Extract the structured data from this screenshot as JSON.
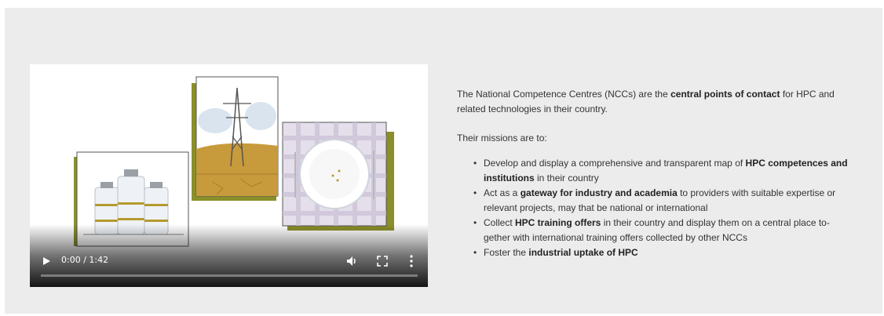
{
  "video": {
    "time": "0:00 / 1:42",
    "progress": 0,
    "icons": {
      "play": "play-icon",
      "volume": "volume-icon",
      "fullscreen": "fullscreen-icon",
      "more": "more-options-icon"
    },
    "illustration": [
      "medicine-bottles",
      "power-pylon-drought",
      "empty-plate-tablecloth"
    ]
  },
  "content": {
    "intro_a": "The National Competence Centres (NCCs) are the ",
    "intro_bold": "central points of contact",
    "intro_b": " for HPC and related technologies in their country.",
    "missions_heading": "Their missions are to:",
    "items": [
      {
        "pre": "Develop and display a comprehensive and transparent map of ",
        "bold": "HPC competences and institutions",
        "post": " in their country"
      },
      {
        "pre": "Act as a ",
        "bold": "gateway for industry and academia",
        "post": " to providers with suitable expertise or relevant projects, may that be national or international"
      },
      {
        "pre": "Collect ",
        "bold": "HPC training offers",
        "post": " in their country and display them on a central place to­gether with international training offers collected by other NCCs"
      },
      {
        "pre": "Foster the ",
        "bold": "industrial uptake of HPC",
        "post": ""
      }
    ]
  },
  "colors": {
    "panel_bg": "#ececec",
    "olive": "#8a8f2a",
    "bottle_band": "#b59a2e",
    "earth": "#c79a3b",
    "tablecloth": "#c9c0d6"
  }
}
